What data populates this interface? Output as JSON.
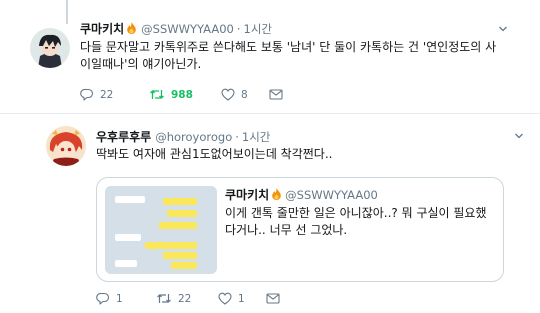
{
  "tweets": [
    {
      "name": "쿠마키치",
      "handle": "@SSWWYYAA00",
      "separator": "·",
      "time": "1시간",
      "text": "다들 문자말고 카톡위주로 쓴다해도 보통 '남녀' 단 둘이 카톡하는 건 '연인정도의 사이일때나'의 얘기아닌가.",
      "actions": {
        "reply": "22",
        "retweet": "988",
        "like": "8"
      }
    },
    {
      "name": "우후루후루",
      "handle": "@horoyorogo",
      "separator": "·",
      "time": "1시간",
      "text": "딱봐도 여자애 관심1도없어보이는데 착각쩐다..",
      "actions": {
        "reply": "1",
        "retweet": "22",
        "like": "1"
      },
      "quote": {
        "name": "쿠마키치",
        "handle": "@SSWWYYAA00",
        "text": "이게 갠톡 줄만한 일은 아니잖아..? 뭐 구실이 필요했다거나.. 너무 선 그었나."
      }
    }
  ],
  "icons": {
    "reply": "reply-icon",
    "retweet": "retweet-icon",
    "like": "heart-icon",
    "message": "direct-message-icon",
    "more": "chevron-down-icon",
    "badge": "fire-icon"
  },
  "colors": {
    "text": "#14171a",
    "secondary": "#657786",
    "retweeted": "#17bf63",
    "border": "#ccd6dd"
  }
}
